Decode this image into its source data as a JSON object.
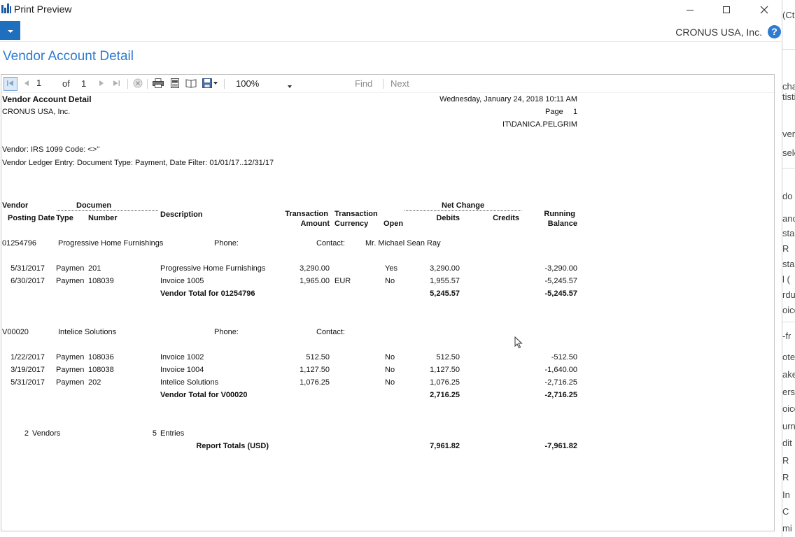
{
  "window": {
    "title": "Print Preview",
    "company": "CRONUS USA, Inc.",
    "page_title": "Vendor Account Detail"
  },
  "toolbar": {
    "page_current": "1",
    "page_of": "of",
    "page_total": "1",
    "zoom": "100%",
    "find": "Find",
    "next": "Next"
  },
  "report": {
    "title": "Vendor Account Detail",
    "company": "CRONUS USA, Inc.",
    "datetime": "Wednesday, January 24, 2018 10:11 AM",
    "page_label": "Page",
    "page_number": "1",
    "user": "IT\\DANICA.PELGRIM",
    "filter_vendor": "Vendor: IRS 1099 Code: <>''",
    "filter_ledger": "Vendor Ledger Entry: Document Type: Payment, Date Filter: 01/01/17..12/31/17",
    "headers": {
      "vendor": "Vendor",
      "posting_date": "Posting Date",
      "document": "Documen",
      "type": "Type",
      "number": "Number",
      "description": "Description",
      "trans_amount_1": "Transaction",
      "trans_amount_2": "Amount",
      "trans_currency_1": "Transaction",
      "trans_currency_2": "Currency",
      "open": "Open",
      "net_change": "Net Change",
      "debits": "Debits",
      "credits": "Credits",
      "running_1": "Running",
      "running_2": "Balance"
    },
    "vendors": [
      {
        "code": "01254796",
        "name": "Progressive Home Furnishings",
        "phone_label": "Phone:",
        "contact_label": "Contact:",
        "contact": "Mr. Michael Sean Ray",
        "entries": [
          {
            "date": "5/31/2017",
            "type": "Paymen",
            "number": "201",
            "description": "Progressive Home Furnishings",
            "amount": "3,290.00",
            "currency": "",
            "open": "Yes",
            "debits": "3,290.00",
            "balance": "-3,290.00"
          },
          {
            "date": "6/30/2017",
            "type": "Paymen",
            "number": "108039",
            "description": "Invoice 1005",
            "amount": "1,965.00",
            "currency": "EUR",
            "open": "No",
            "debits": "1,955.57",
            "balance": "-5,245.57"
          }
        ],
        "total_label": "Vendor Total for 01254796",
        "total_debits": "5,245.57",
        "total_balance": "-5,245.57"
      },
      {
        "code": "V00020",
        "name": "Intelice Solutions",
        "phone_label": "Phone:",
        "contact_label": "Contact:",
        "contact": "",
        "entries": [
          {
            "date": "1/22/2017",
            "type": "Paymen",
            "number": "108036",
            "description": "Invoice 1002",
            "amount": "512.50",
            "currency": "",
            "open": "No",
            "debits": "512.50",
            "balance": "-512.50"
          },
          {
            "date": "3/19/2017",
            "type": "Paymen",
            "number": "108038",
            "description": "Invoice 1004",
            "amount": "1,127.50",
            "currency": "",
            "open": "No",
            "debits": "1,127.50",
            "balance": "-1,640.00"
          },
          {
            "date": "5/31/2017",
            "type": "Paymen",
            "number": "202",
            "description": "Intelice Solutions",
            "amount": "1,076.25",
            "currency": "",
            "open": "No",
            "debits": "1,076.25",
            "balance": "-2,716.25"
          }
        ],
        "total_label": "Vendor Total for V00020",
        "total_debits": "2,716.25",
        "total_balance": "-2,716.25"
      }
    ],
    "summary": {
      "vendors_count": "2",
      "vendors_label": "Vendors",
      "entries_count": "5",
      "entries_label": "Entries",
      "totals_label": "Report Totals (USD)",
      "total_debits": "7,961.82",
      "total_balance": "-7,961.82"
    }
  },
  "background_app": {
    "fragments": [
      "(Ct",
      "cha",
      "tisti",
      "ver",
      "sele",
      "do",
      "anc",
      "sta",
      "R",
      "sta",
      "l (",
      "rdu",
      "oice",
      "-fr",
      "otes",
      "ake",
      "ers",
      "oice",
      "urn",
      "dit",
      "R",
      "R",
      "In",
      "C",
      "mi"
    ]
  }
}
